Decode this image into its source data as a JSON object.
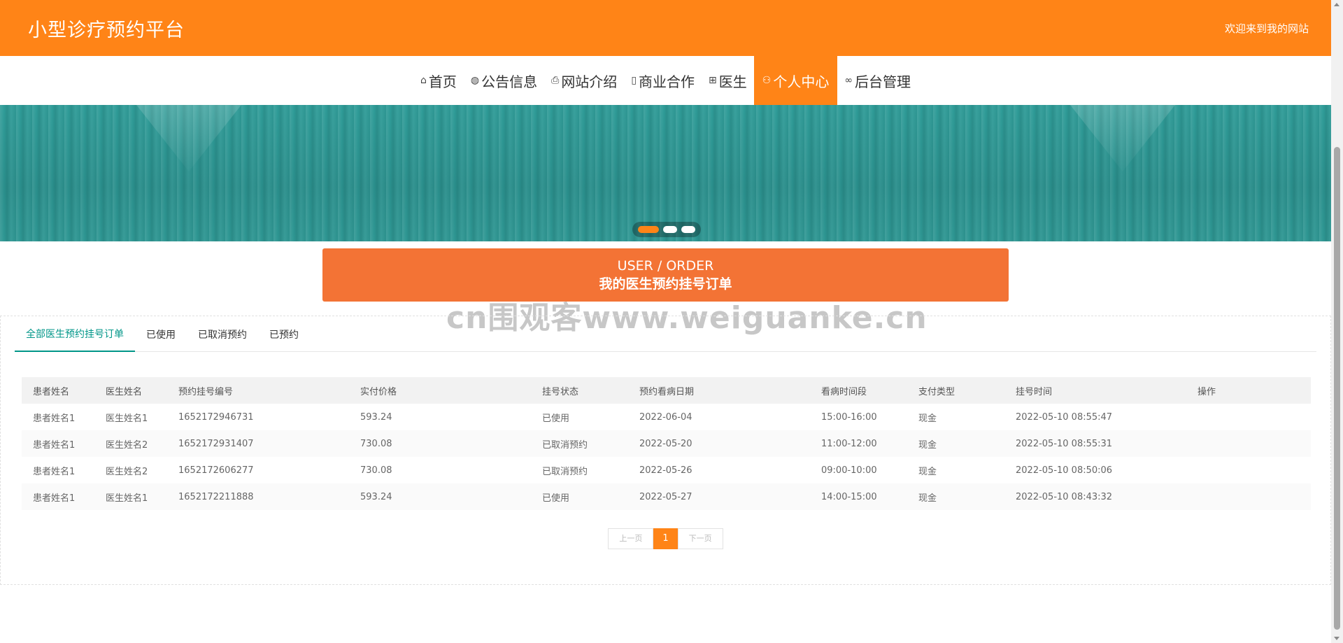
{
  "header": {
    "title": "小型诊疗预约平台",
    "welcome": "欢迎来到我的网站"
  },
  "nav": {
    "items": [
      {
        "label": "首页",
        "icon": "⌂"
      },
      {
        "label": "公告信息",
        "icon": "◍"
      },
      {
        "label": "网站介绍",
        "icon": "⎙"
      },
      {
        "label": "商业合作",
        "icon": "▯"
      },
      {
        "label": "医生",
        "icon": "⊞"
      },
      {
        "label": "个人中心",
        "icon": "⚇"
      },
      {
        "label": "后台管理",
        "icon": "∞"
      }
    ]
  },
  "section": {
    "en": "USER / ORDER",
    "cn": "我的医生预约挂号订单"
  },
  "watermark": "cn围观客www.weiguanke.cn",
  "tabs": [
    "全部医生预约挂号订单",
    "已使用",
    "已取消预约",
    "已预约"
  ],
  "table": {
    "headers": [
      "患者姓名",
      "医生姓名",
      "预约挂号编号",
      "实付价格",
      "挂号状态",
      "预约看病日期",
      "看病时间段",
      "支付类型",
      "挂号时间",
      "操作"
    ],
    "rows": [
      [
        "患者姓名1",
        "医生姓名1",
        "1652172946731",
        "593.24",
        "已使用",
        "2022-06-04",
        "15:00-16:00",
        "现金",
        "2022-05-10 08:55:47",
        ""
      ],
      [
        "患者姓名1",
        "医生姓名2",
        "1652172931407",
        "730.08",
        "已取消预约",
        "2022-05-20",
        "11:00-12:00",
        "现金",
        "2022-05-10 08:55:31",
        ""
      ],
      [
        "患者姓名1",
        "医生姓名2",
        "1652172606277",
        "730.08",
        "已取消预约",
        "2022-05-26",
        "09:00-10:00",
        "现金",
        "2022-05-10 08:50:06",
        ""
      ],
      [
        "患者姓名1",
        "医生姓名1",
        "1652172211888",
        "593.24",
        "已使用",
        "2022-05-27",
        "14:00-15:00",
        "现金",
        "2022-05-10 08:43:32",
        ""
      ]
    ]
  },
  "pagination": {
    "prev": "上一页",
    "current": "1",
    "next": "下一页"
  },
  "colors": {
    "primary": "#ff8417",
    "section": "#f37335",
    "tab_active": "#009688",
    "banner": "#2a8f8c"
  }
}
